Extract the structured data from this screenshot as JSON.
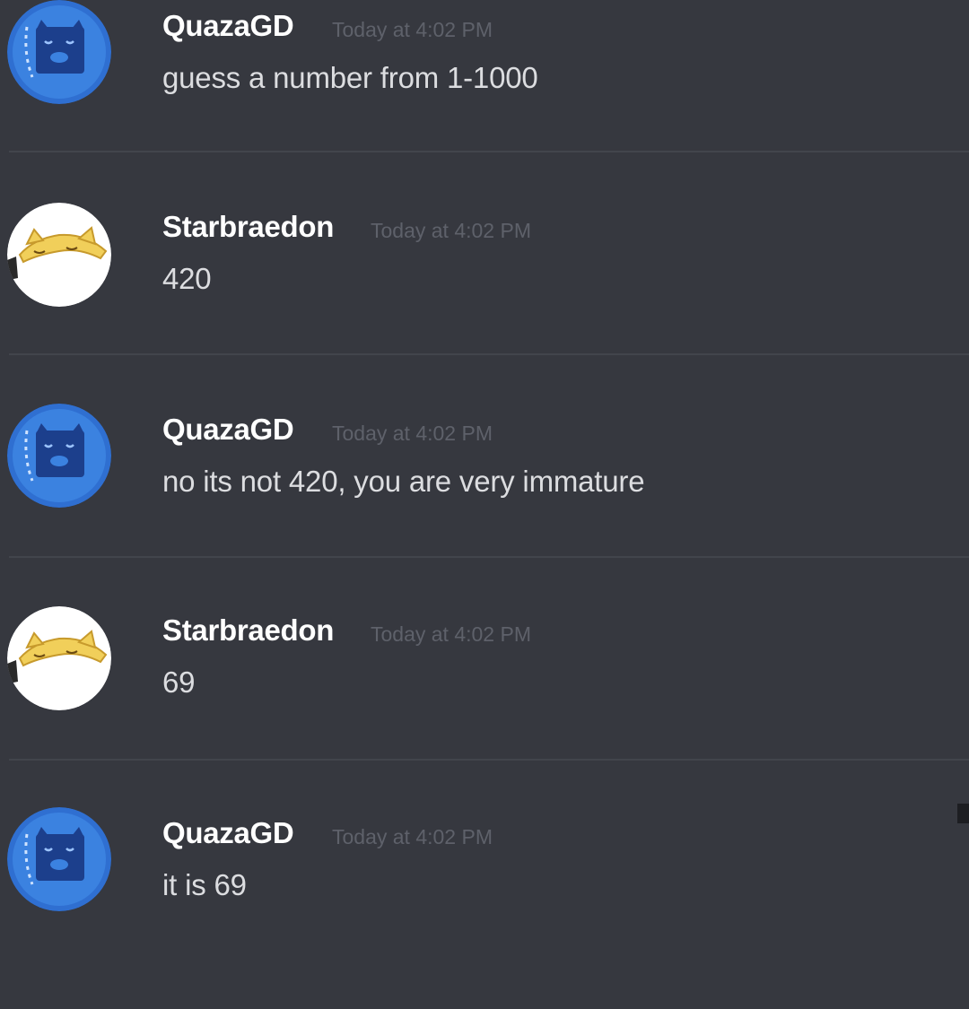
{
  "colors": {
    "background": "#36383f",
    "divider": "#42454c",
    "username": "#ffffff",
    "timestamp": "#5e616a",
    "message_text": "#dcdde0",
    "avatar_quaza": "#2f6fd1",
    "avatar_star": "#ffffff"
  },
  "messages": [
    {
      "author": "QuazaGD",
      "avatar_icon": "blue-cat-avatar-icon",
      "timestamp": "Today at 4:02 PM",
      "text": "guess a number from 1-1000"
    },
    {
      "author": "Starbraedon",
      "avatar_icon": "yellow-cat-avatar-icon",
      "timestamp": "Today at 4:02 PM",
      "text": "420"
    },
    {
      "author": "QuazaGD",
      "avatar_icon": "blue-cat-avatar-icon",
      "timestamp": "Today at 4:02 PM",
      "text": "no its not 420, you are very immature"
    },
    {
      "author": "Starbraedon",
      "avatar_icon": "yellow-cat-avatar-icon",
      "timestamp": "Today at 4:02 PM",
      "text": "69"
    },
    {
      "author": "QuazaGD",
      "avatar_icon": "blue-cat-avatar-icon",
      "timestamp": "Today at 4:02 PM",
      "text": "it is 69"
    }
  ]
}
